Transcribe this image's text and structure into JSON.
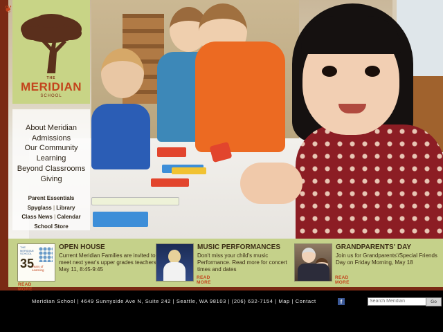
{
  "logo": {
    "the": "THE",
    "name": "MERIDIAN",
    "school": "SCHOOL"
  },
  "nav": {
    "main": [
      "About Meridian",
      "Admissions",
      "Our Community",
      "Learning",
      "Beyond Classrooms",
      "Giving"
    ],
    "parent_essentials": "Parent Essentials",
    "spyglass": "Spyglass",
    "library": "Library",
    "class_news": "Class News",
    "calendar": "Calendar",
    "school_store": "School Store",
    "separator": "|"
  },
  "promos": [
    {
      "title": "OPEN HOUSE",
      "body": "Current Meridian Families are invited to meet next year's upper grades teachers. May 11, 8:45-9:45",
      "more": "READ MORE",
      "thumb_text_small": "THE MERIDIAN SCHOOL",
      "thumb_text_big": "35",
      "thumb_text_caption": "Years of Learning"
    },
    {
      "title": "MUSIC PERFORMANCES",
      "body": "Don't miss your child's music Performance. Read more for concert times and dates",
      "more": "READ MORE"
    },
    {
      "title": "GRANDPARENTS' DAY",
      "body": "Join us for Grandparents'/Special Friends Day on Friday Morning, May 18",
      "more": "READ MORE"
    }
  ],
  "footer": {
    "text": "Meridian School | 4649 Sunnyside Ave N, Suite 242 | Seattle, WA 98103 | (206) 632-7154 | Map | Contact",
    "facebook": "f",
    "search_placeholder": "Search Meridian",
    "go_label": "Go"
  },
  "colors": {
    "brand_orange": "#c3441c",
    "logo_green": "#c8d486",
    "band_green": "#c5d18a",
    "frame_red": "#7a2a14"
  }
}
